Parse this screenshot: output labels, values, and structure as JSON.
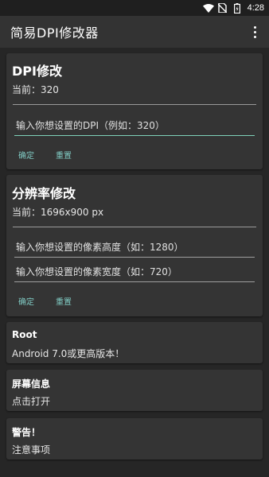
{
  "status": {
    "time": "4:28",
    "icons": [
      "wifi-icon",
      "no-sim-icon",
      "battery-icon"
    ]
  },
  "appbar": {
    "title": "简易DPI修改器",
    "menu_icon": "more-vert-icon"
  },
  "dpi_card": {
    "title": "DPI修改",
    "current": "当前：320",
    "input_text": "输入你想设置的DPI（例如：320）",
    "confirm": "确定",
    "reset": "重置"
  },
  "resolution_card": {
    "title": "分辨率修改",
    "current": "当前：1696x900 px",
    "height_input": "输入你想设置的像素高度（如：1280）",
    "width_input": "输入你想设置的像素宽度（如：720）",
    "confirm": "确定",
    "reset": "重置"
  },
  "root_card": {
    "title": "Root",
    "text": "Android 7.0或更高版本！"
  },
  "screen_card": {
    "title": "屏幕信息",
    "text": "点击打开"
  },
  "warning_card": {
    "title": "警告！",
    "text": "注意事项"
  },
  "colors": {
    "background": "#262626",
    "card": "#343434",
    "appbar": "#333333",
    "accent": "#80cbc4"
  }
}
